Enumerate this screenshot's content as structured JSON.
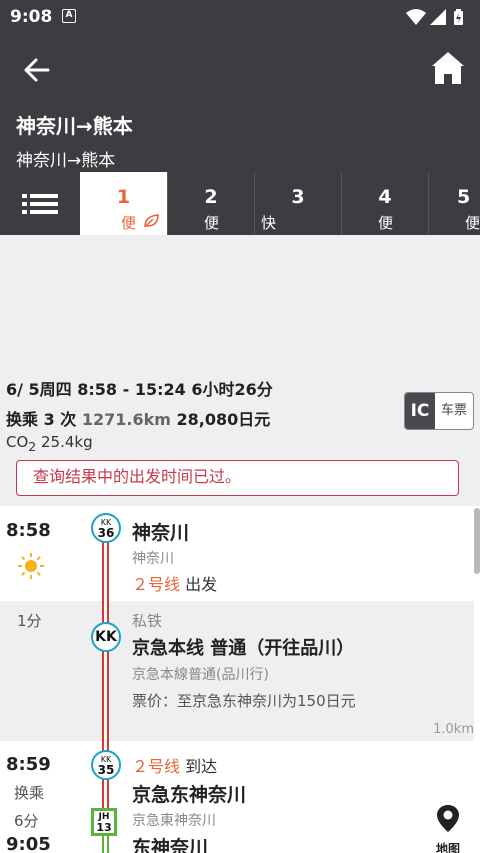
{
  "status_bar": {
    "time": "9:08",
    "notif": "A"
  },
  "header": {
    "title": "神奈川→熊本",
    "subtitle": "神奈川→熊本"
  },
  "tabs": [
    {
      "num": "1",
      "kind": "便",
      "active": true
    },
    {
      "num": "2",
      "kind": "便"
    },
    {
      "num": "3",
      "kind": "快"
    },
    {
      "num": "4",
      "kind": "便"
    },
    {
      "num": "5",
      "kind": "便"
    }
  ],
  "summary": {
    "line1": "6/ 5周四 8:58 - 15:24 6小时26分",
    "transfers": "换乘 3 次",
    "distance": "1271.6km",
    "fare": "28,080日元",
    "co2_label": "CO",
    "co2_sub": "2",
    "co2_value": " 25.4kg",
    "ic_label": "IC",
    "ticket_label": "车票"
  },
  "warning": "查询结果中的出发时间已过。",
  "route": {
    "dep_time": "8:58",
    "station1": {
      "name": "神奈川",
      "sub": "神奈川",
      "badge_top": "KK",
      "badge_num": "36",
      "platform": "２号线",
      "platform_action": "出发"
    },
    "segment": {
      "duration": "1分",
      "operator": "私铁",
      "badge": "KK",
      "line": "京急本线 普通（开往品川）",
      "line_sub": "京急本線普通(品川行)",
      "fare": "票价：至京急东神奈川为150日元",
      "distance": "1.0km"
    },
    "arr_time": "8:59",
    "transfer_label": "换乘",
    "transfer_wait": "6分",
    "station2": {
      "platform": "２号线",
      "platform_action": "到达",
      "name": "京急东神奈川",
      "sub": "京急東神奈川",
      "badge_top": "KK",
      "badge_num": "35"
    },
    "next_time": "9:05",
    "station3": {
      "name": "东神奈川",
      "badge_top": "JH",
      "badge_num": "13"
    },
    "map_label": "地图"
  }
}
